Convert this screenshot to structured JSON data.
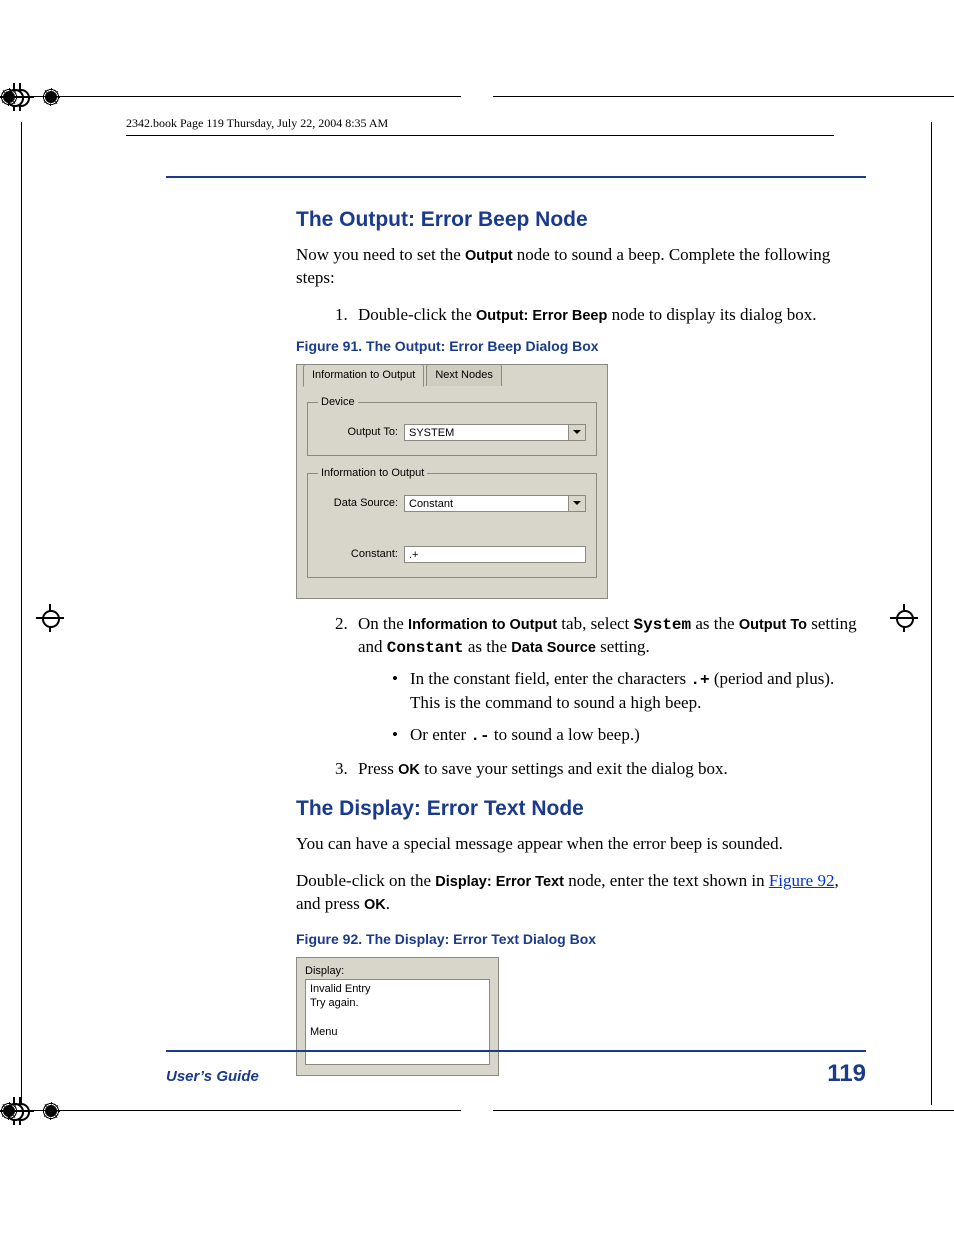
{
  "meta": {
    "header_line": "2342.book  Page 119  Thursday, July 22, 2004  8:35 AM"
  },
  "section1": {
    "heading": "The Output: Error Beep Node",
    "intro_pre": "Now you need to set the ",
    "intro_bold": "Output",
    "intro_post": " node to sound a beep. Complete the following steps:",
    "step1_pre": "Double-click the ",
    "step1_bold": "Output: Error Beep",
    "step1_post": " node to display its dialog box.",
    "fig_caption": "Figure 91. The Output: Error Beep Dialog Box",
    "dialog1": {
      "tab_active": "Information to Output",
      "tab_other": "Next Nodes",
      "group_device": "Device",
      "output_to_label": "Output To:",
      "output_to_value": "SYSTEM",
      "group_info": "Information to Output",
      "data_source_label": "Data Source:",
      "data_source_value": "Constant",
      "constant_label": "Constant:",
      "constant_value": ".+"
    },
    "step2": {
      "p1": "On the ",
      "b1": "Information to Output",
      "p2": " tab, select ",
      "m1": "System",
      "p3": " as the ",
      "b2": "Output To",
      "p4": " setting and ",
      "m2": "Constant",
      "p5": " as the ",
      "b3": "Data Source",
      "p6": " setting.",
      "sub1_a": "In the constant field, enter the characters   ",
      "sub1_m": ".+",
      "sub1_b": " (period and plus). This is the command to sound a high beep.",
      "sub2_a": "Or enter ",
      "sub2_m": ".-",
      "sub2_b": " to sound a low beep.)"
    },
    "step3_a": "Press ",
    "step3_b": "OK",
    "step3_c": " to save your settings and exit the dialog box."
  },
  "section2": {
    "heading": "The Display: Error Text Node",
    "intro": "You can have a special message appear when the error beep is sounded.",
    "p2_a": "Double-click on the ",
    "p2_b": "Display: Error Text",
    "p2_c": " node, enter the text shown in ",
    "p2_link": "Figure 92",
    "p2_d": ", and press ",
    "p2_e": "OK",
    "p2_f": ".",
    "fig_caption": "Figure 92. The Display: Error Text Dialog Box",
    "dialog2": {
      "label": "Display:",
      "text": "Invalid Entry\nTry again.\n\nMenu"
    }
  },
  "footer": {
    "label": "User’s Guide",
    "page": "119"
  }
}
